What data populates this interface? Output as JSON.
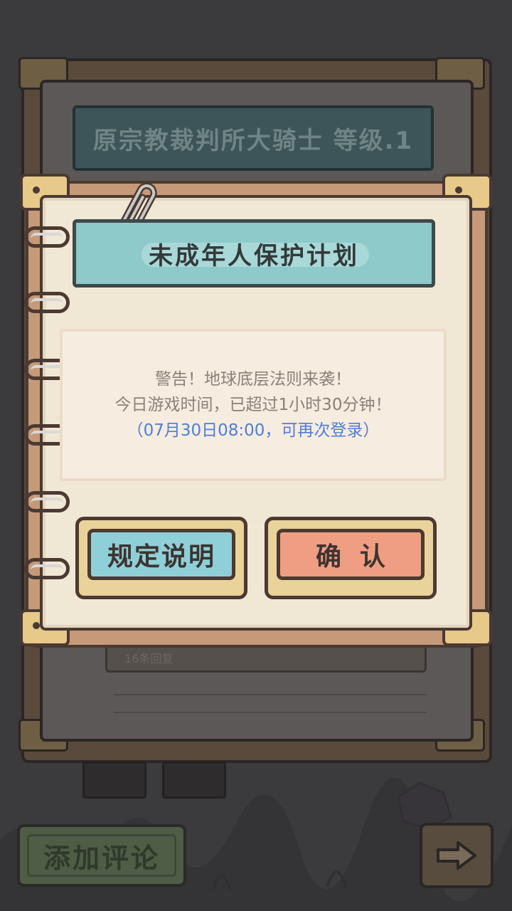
{
  "background": {
    "panel_title": "原宗教裁判所大骑士  等级.1",
    "comment_count_text": "16条回复",
    "add_comment_label": "添加评论",
    "next_icon": "arrow-right-icon"
  },
  "modal": {
    "title": "未成年人保护计划",
    "message": {
      "line1": "警告！地球底层法则来袭！",
      "line2": "今日游戏时间，已超过1小时30分钟！",
      "line3": "（07月30日08:00，可再次登录）"
    },
    "rules_button_label": "规定说明",
    "confirm_button_label": "确认",
    "clip_icon": "paperclip-icon",
    "binding_icon": "notebook-ring-icon"
  },
  "colors": {
    "title_bar": "#8fcacb",
    "rules_button": "#8fcfd8",
    "confirm_button": "#ef9e84",
    "highlight_text": "#4e7fd6",
    "paper": "#f1e7d5"
  }
}
